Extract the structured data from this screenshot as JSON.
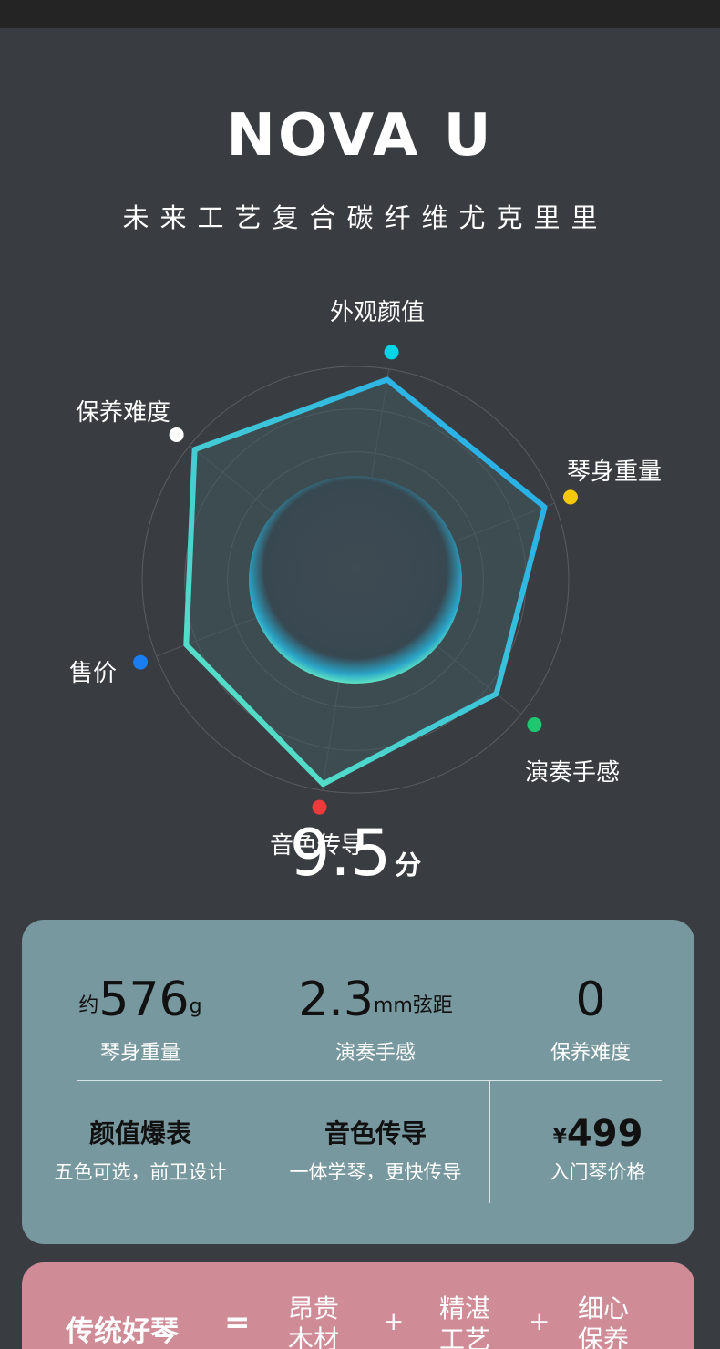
{
  "header": {
    "title": "NOVA U",
    "subtitle": "未来工艺复合碳纤维尤克里里"
  },
  "radar": {
    "score": "9.5",
    "score_unit": "分",
    "axes": [
      {
        "label": "外观颜值",
        "dot_color": "#00d4e6"
      },
      {
        "label": "琴身重量",
        "dot_color": "#f5c80a"
      },
      {
        "label": "演奏手感",
        "dot_color": "#1cc870"
      },
      {
        "label": "音色传导",
        "dot_color": "#ef3b3b"
      },
      {
        "label": "售价",
        "dot_color": "#1a7ef0"
      },
      {
        "label": "保养难度",
        "dot_color": "#ffffff"
      }
    ],
    "values": [
      0.95,
      0.95,
      0.85,
      0.97,
      0.85,
      0.97
    ]
  },
  "stats": {
    "weight": {
      "prefix": "约",
      "value": "576",
      "suffix": "g",
      "label": "琴身重量"
    },
    "action": {
      "prefix": "",
      "value": "2.3",
      "suffix": "mm弦距",
      "label": "演奏手感"
    },
    "maintenance": {
      "prefix": "",
      "value": "0",
      "suffix": "",
      "label": "保养难度"
    }
  },
  "features": {
    "looks": {
      "title": "颜值爆表",
      "desc": "五色可选，前卫设计"
    },
    "tone": {
      "title": "音色传导",
      "desc": "一体学琴，更快传导"
    },
    "price": {
      "symbol": "¥",
      "value": "499",
      "desc": "入门琴价格"
    }
  },
  "compare": {
    "title": "传统好琴",
    "equals": "=",
    "items": [
      {
        "line1": "昂贵",
        "line2": "木材"
      },
      {
        "line1": "精湛",
        "line2": "工艺"
      },
      {
        "line1": "细心",
        "line2": "保养"
      }
    ],
    "plus": "+"
  }
}
